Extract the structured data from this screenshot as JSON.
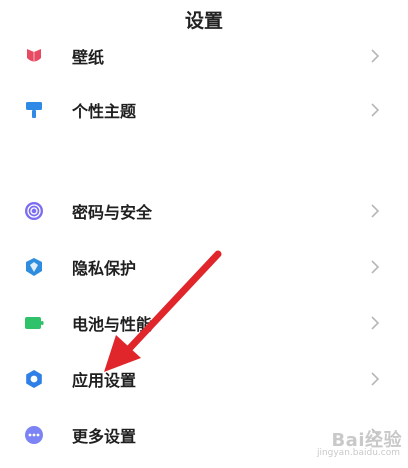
{
  "header": {
    "title": "设置"
  },
  "items": [
    {
      "id": "wallpaper",
      "label": "壁纸",
      "icon": "wallpaper-icon",
      "color": "#e84a63"
    },
    {
      "id": "themes",
      "label": "个性主题",
      "icon": "theme-brush-icon",
      "color": "#2f8ae5"
    },
    {
      "id": "security",
      "label": "密码与安全",
      "icon": "fingerprint-icon",
      "color": "#7b6df0"
    },
    {
      "id": "privacy",
      "label": "隐私保护",
      "icon": "privacy-shield-icon",
      "color": "#2e8ddf"
    },
    {
      "id": "battery",
      "label": "电池与性能",
      "icon": "battery-icon",
      "color": "#2fc26a"
    },
    {
      "id": "apps",
      "label": "应用设置",
      "icon": "gear-icon",
      "color": "#2f7fe6"
    },
    {
      "id": "more",
      "label": "更多设置",
      "icon": "more-dots-icon",
      "color": "#7c83f5"
    }
  ],
  "annotation": {
    "arrow_color": "#e0252b"
  },
  "watermark": {
    "main": "Bai经验",
    "sub": "jingyan.baidu.com"
  }
}
